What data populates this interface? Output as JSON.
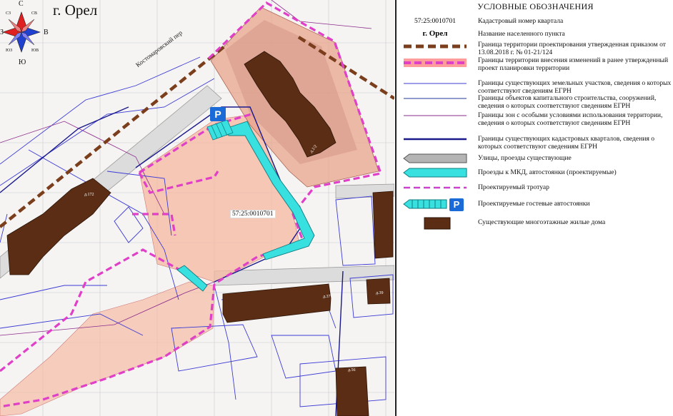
{
  "map": {
    "city_title": "г. Орел",
    "compass": {
      "north": "С",
      "south": "Ю",
      "east": "В",
      "west": "З",
      "nw": "СЗ",
      "ne": "СВ",
      "sw": "ЮЗ",
      "se": "ЮВ"
    },
    "street_label": "Костомаровский пер",
    "quarter_label": "57:25:0010701",
    "parking_icon": "P",
    "building_labels": [
      "д.1/2",
      "д.172",
      "д.37",
      "д.39",
      "д.56"
    ]
  },
  "legend": {
    "title": "УСЛОВНЫЕ ОБОЗНАЧЕНИЯ",
    "sample_quarter_number": "57:25:0010701",
    "sample_city_name": "г. Орел",
    "items": [
      {
        "key": "cadastral-number",
        "label": "Кадастровый номер квартала"
      },
      {
        "key": "settlement-name",
        "label": "Название населенного пункта"
      },
      {
        "key": "design-boundary",
        "label": "Граница территории проектирования утвержденная приказом от 13.08.2018 г. № 01-21/124"
      },
      {
        "key": "changes-boundary",
        "label": "Границы территории внесения изменений в ранее утвержденный проект планировки территории"
      },
      {
        "key": "land-plots",
        "label": "Границы существующих земельных участков, сведения о которых соответствуют сведениям ЕГРН"
      },
      {
        "key": "construction-objects",
        "label": "Границы объектов капитального строительства, сооружений, сведения о которых соответствуют сведениям ЕГРН"
      },
      {
        "key": "special-zones",
        "label": "Границы зон с особыми условиями использования территории, сведения о которых соответствуют сведениям ЕГРН"
      },
      {
        "key": "cadastral-quarters",
        "label": "Границы существующих кадастровых кварталов, сведения о которых соответствуют сведениям ЕГРН"
      },
      {
        "key": "streets",
        "label": "Улицы, проезды существующие"
      },
      {
        "key": "driveways",
        "label": "Проезды к МКД, автостоянки (проектируемые)"
      },
      {
        "key": "sidewalk",
        "label": "Проектируемый тротуар"
      },
      {
        "key": "guest-parking",
        "label": "Проектируемые гостевые автостоянки"
      },
      {
        "key": "apartment-buildings",
        "label": "Существующие многоэтажные жилые дома"
      }
    ],
    "parking_symbol": "P"
  },
  "colors": {
    "design_boundary": "#7a3e1c",
    "changes_boundary_fill": "#ff8c8c",
    "changes_boundary_dash": "#e040c8",
    "land_plots": "#3b3bd6",
    "construction": "#4f5fb0",
    "special_zones": "#8a2a8a",
    "cadastral_quarters": "#1a1a8c",
    "streets": "#b4b4b4",
    "driveway": "#38e0e0",
    "sidewalk": "#d040d0",
    "parking_blue": "#1a6ad8",
    "building": "#5a2d14",
    "salmon_zone": "#f6b8a0"
  }
}
